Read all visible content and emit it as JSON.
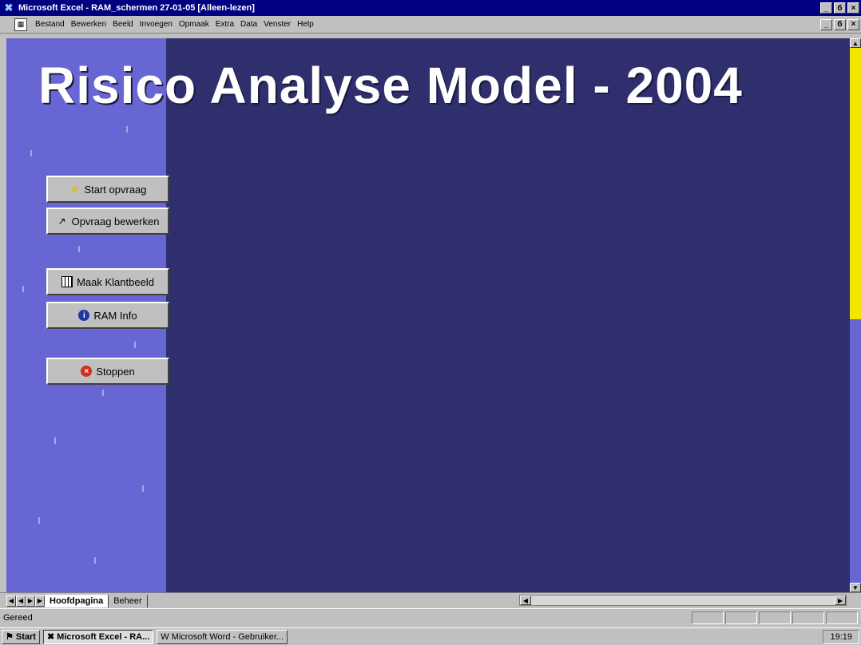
{
  "window": {
    "title": "Microsoft Excel - RAM_schermen 27-01-05  [Alleen-lezen]",
    "app_icon": "excel-icon",
    "controls": [
      "_",
      "б",
      "×"
    ]
  },
  "menu": {
    "items": [
      "Bestand",
      "Bewerken",
      "Beeld",
      "Invoegen",
      "Opmaak",
      "Extra",
      "Data",
      "Venster",
      "Help"
    ],
    "doc_controls": [
      "_",
      "б",
      "×"
    ]
  },
  "sheet": {
    "heading": "Risico Analyse Model - 2004",
    "colors": {
      "background": "#2f2f6e",
      "left_band": "#6766d2",
      "scroll_thumb": "#f2e600"
    }
  },
  "buttons": [
    {
      "label": "Start opvraag",
      "icon": "lightbulb-icon",
      "glyph": "❀"
    },
    {
      "label": "Opvraag bewerken",
      "icon": "pick-icon",
      "glyph": "↗"
    },
    {
      "label": "Maak Klantbeeld",
      "icon": "table-icon",
      "glyph": ""
    },
    {
      "label": "RAM Info",
      "icon": "info-icon",
      "glyph": "i"
    },
    {
      "label": "Stoppen",
      "icon": "stop-icon",
      "glyph": "×"
    }
  ],
  "tabs": [
    "Hoofdpagina",
    "Beheer"
  ],
  "status": {
    "text": "Gereed"
  },
  "taskbar": {
    "start": "Start",
    "items": [
      "Microsoft Excel - RA...",
      "Microsoft Word - Gebruiker..."
    ],
    "clock": "19:19"
  }
}
